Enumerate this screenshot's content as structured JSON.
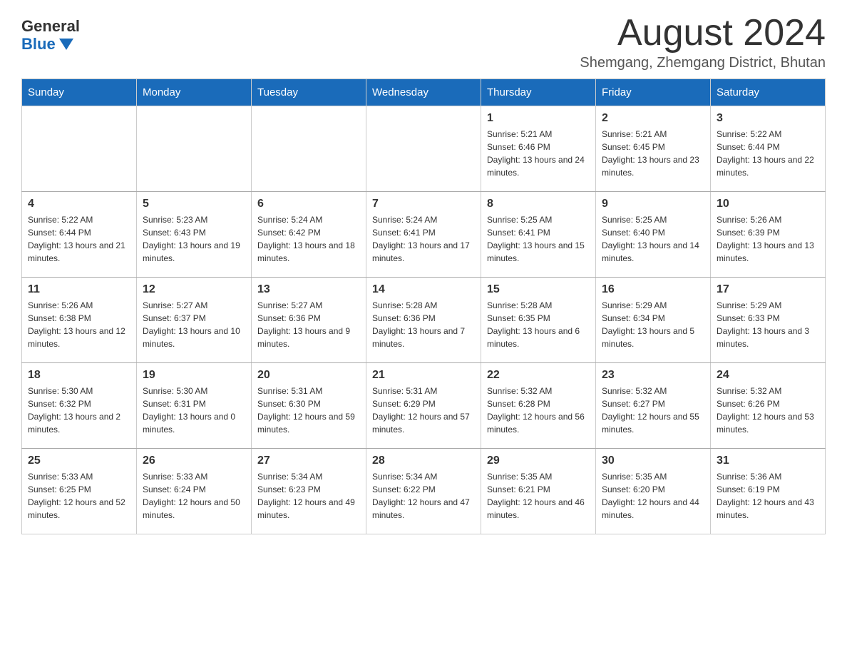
{
  "logo": {
    "general": "General",
    "blue": "Blue"
  },
  "title": "August 2024",
  "location": "Shemgang, Zhemgang District, Bhutan",
  "days_of_week": [
    "Sunday",
    "Monday",
    "Tuesday",
    "Wednesday",
    "Thursday",
    "Friday",
    "Saturday"
  ],
  "weeks": [
    [
      {
        "day": "",
        "sunrise": "",
        "sunset": "",
        "daylight": ""
      },
      {
        "day": "",
        "sunrise": "",
        "sunset": "",
        "daylight": ""
      },
      {
        "day": "",
        "sunrise": "",
        "sunset": "",
        "daylight": ""
      },
      {
        "day": "",
        "sunrise": "",
        "sunset": "",
        "daylight": ""
      },
      {
        "day": "1",
        "sunrise": "Sunrise: 5:21 AM",
        "sunset": "Sunset: 6:46 PM",
        "daylight": "Daylight: 13 hours and 24 minutes."
      },
      {
        "day": "2",
        "sunrise": "Sunrise: 5:21 AM",
        "sunset": "Sunset: 6:45 PM",
        "daylight": "Daylight: 13 hours and 23 minutes."
      },
      {
        "day": "3",
        "sunrise": "Sunrise: 5:22 AM",
        "sunset": "Sunset: 6:44 PM",
        "daylight": "Daylight: 13 hours and 22 minutes."
      }
    ],
    [
      {
        "day": "4",
        "sunrise": "Sunrise: 5:22 AM",
        "sunset": "Sunset: 6:44 PM",
        "daylight": "Daylight: 13 hours and 21 minutes."
      },
      {
        "day": "5",
        "sunrise": "Sunrise: 5:23 AM",
        "sunset": "Sunset: 6:43 PM",
        "daylight": "Daylight: 13 hours and 19 minutes."
      },
      {
        "day": "6",
        "sunrise": "Sunrise: 5:24 AM",
        "sunset": "Sunset: 6:42 PM",
        "daylight": "Daylight: 13 hours and 18 minutes."
      },
      {
        "day": "7",
        "sunrise": "Sunrise: 5:24 AM",
        "sunset": "Sunset: 6:41 PM",
        "daylight": "Daylight: 13 hours and 17 minutes."
      },
      {
        "day": "8",
        "sunrise": "Sunrise: 5:25 AM",
        "sunset": "Sunset: 6:41 PM",
        "daylight": "Daylight: 13 hours and 15 minutes."
      },
      {
        "day": "9",
        "sunrise": "Sunrise: 5:25 AM",
        "sunset": "Sunset: 6:40 PM",
        "daylight": "Daylight: 13 hours and 14 minutes."
      },
      {
        "day": "10",
        "sunrise": "Sunrise: 5:26 AM",
        "sunset": "Sunset: 6:39 PM",
        "daylight": "Daylight: 13 hours and 13 minutes."
      }
    ],
    [
      {
        "day": "11",
        "sunrise": "Sunrise: 5:26 AM",
        "sunset": "Sunset: 6:38 PM",
        "daylight": "Daylight: 13 hours and 12 minutes."
      },
      {
        "day": "12",
        "sunrise": "Sunrise: 5:27 AM",
        "sunset": "Sunset: 6:37 PM",
        "daylight": "Daylight: 13 hours and 10 minutes."
      },
      {
        "day": "13",
        "sunrise": "Sunrise: 5:27 AM",
        "sunset": "Sunset: 6:36 PM",
        "daylight": "Daylight: 13 hours and 9 minutes."
      },
      {
        "day": "14",
        "sunrise": "Sunrise: 5:28 AM",
        "sunset": "Sunset: 6:36 PM",
        "daylight": "Daylight: 13 hours and 7 minutes."
      },
      {
        "day": "15",
        "sunrise": "Sunrise: 5:28 AM",
        "sunset": "Sunset: 6:35 PM",
        "daylight": "Daylight: 13 hours and 6 minutes."
      },
      {
        "day": "16",
        "sunrise": "Sunrise: 5:29 AM",
        "sunset": "Sunset: 6:34 PM",
        "daylight": "Daylight: 13 hours and 5 minutes."
      },
      {
        "day": "17",
        "sunrise": "Sunrise: 5:29 AM",
        "sunset": "Sunset: 6:33 PM",
        "daylight": "Daylight: 13 hours and 3 minutes."
      }
    ],
    [
      {
        "day": "18",
        "sunrise": "Sunrise: 5:30 AM",
        "sunset": "Sunset: 6:32 PM",
        "daylight": "Daylight: 13 hours and 2 minutes."
      },
      {
        "day": "19",
        "sunrise": "Sunrise: 5:30 AM",
        "sunset": "Sunset: 6:31 PM",
        "daylight": "Daylight: 13 hours and 0 minutes."
      },
      {
        "day": "20",
        "sunrise": "Sunrise: 5:31 AM",
        "sunset": "Sunset: 6:30 PM",
        "daylight": "Daylight: 12 hours and 59 minutes."
      },
      {
        "day": "21",
        "sunrise": "Sunrise: 5:31 AM",
        "sunset": "Sunset: 6:29 PM",
        "daylight": "Daylight: 12 hours and 57 minutes."
      },
      {
        "day": "22",
        "sunrise": "Sunrise: 5:32 AM",
        "sunset": "Sunset: 6:28 PM",
        "daylight": "Daylight: 12 hours and 56 minutes."
      },
      {
        "day": "23",
        "sunrise": "Sunrise: 5:32 AM",
        "sunset": "Sunset: 6:27 PM",
        "daylight": "Daylight: 12 hours and 55 minutes."
      },
      {
        "day": "24",
        "sunrise": "Sunrise: 5:32 AM",
        "sunset": "Sunset: 6:26 PM",
        "daylight": "Daylight: 12 hours and 53 minutes."
      }
    ],
    [
      {
        "day": "25",
        "sunrise": "Sunrise: 5:33 AM",
        "sunset": "Sunset: 6:25 PM",
        "daylight": "Daylight: 12 hours and 52 minutes."
      },
      {
        "day": "26",
        "sunrise": "Sunrise: 5:33 AM",
        "sunset": "Sunset: 6:24 PM",
        "daylight": "Daylight: 12 hours and 50 minutes."
      },
      {
        "day": "27",
        "sunrise": "Sunrise: 5:34 AM",
        "sunset": "Sunset: 6:23 PM",
        "daylight": "Daylight: 12 hours and 49 minutes."
      },
      {
        "day": "28",
        "sunrise": "Sunrise: 5:34 AM",
        "sunset": "Sunset: 6:22 PM",
        "daylight": "Daylight: 12 hours and 47 minutes."
      },
      {
        "day": "29",
        "sunrise": "Sunrise: 5:35 AM",
        "sunset": "Sunset: 6:21 PM",
        "daylight": "Daylight: 12 hours and 46 minutes."
      },
      {
        "day": "30",
        "sunrise": "Sunrise: 5:35 AM",
        "sunset": "Sunset: 6:20 PM",
        "daylight": "Daylight: 12 hours and 44 minutes."
      },
      {
        "day": "31",
        "sunrise": "Sunrise: 5:36 AM",
        "sunset": "Sunset: 6:19 PM",
        "daylight": "Daylight: 12 hours and 43 minutes."
      }
    ]
  ]
}
